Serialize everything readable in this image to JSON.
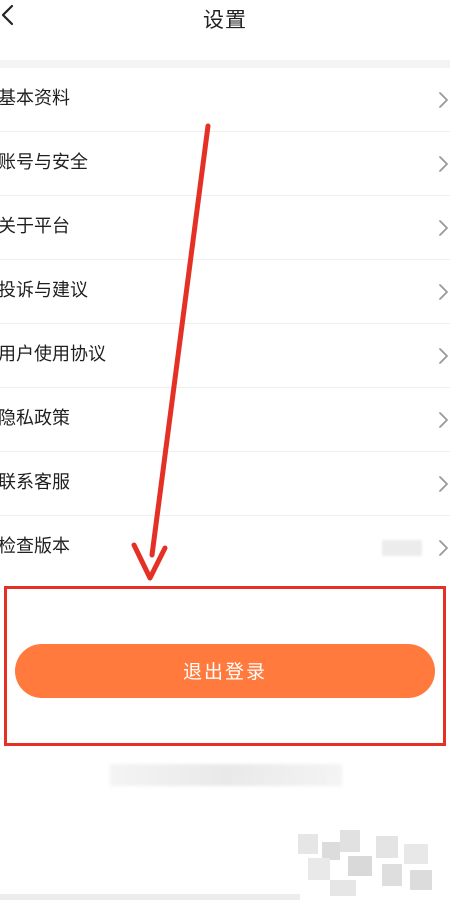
{
  "header": {
    "title": "设置"
  },
  "menu": {
    "items": [
      {
        "label": "基本资料"
      },
      {
        "label": "账号与安全"
      },
      {
        "label": "关于平台"
      },
      {
        "label": "投诉与建议"
      },
      {
        "label": "用户使用协议"
      },
      {
        "label": "隐私政策"
      },
      {
        "label": "联系客服"
      },
      {
        "label": "检查版本"
      }
    ]
  },
  "logout": {
    "label": "退出登录"
  },
  "colors": {
    "accent": "#ff7a3c",
    "annotation_red": "#e53026",
    "divider": "#eeeeee",
    "text": "#1f1f1f",
    "chevron": "#999999"
  },
  "icons": {
    "back": "chevron-left-icon",
    "item_arrow": "chevron-right-icon"
  }
}
